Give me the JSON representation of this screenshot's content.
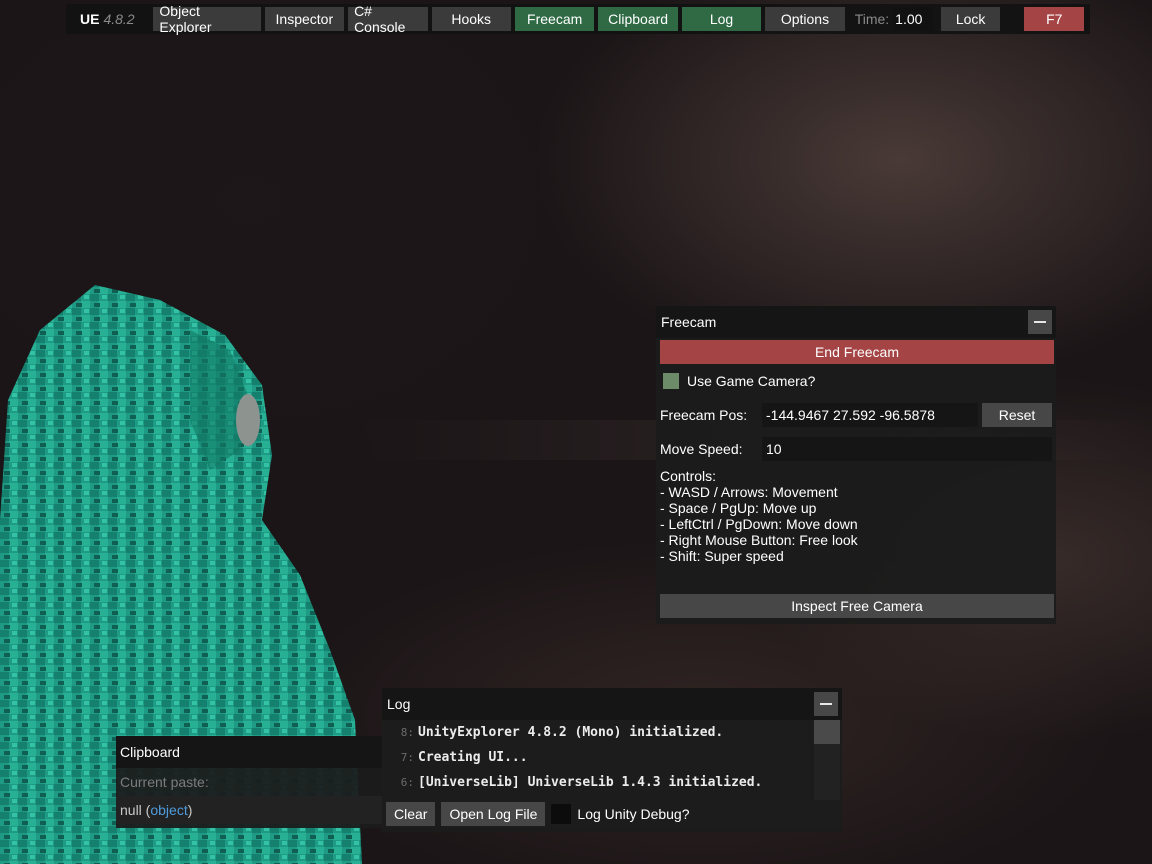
{
  "toolbar": {
    "brand": "UE",
    "version": "4.8.2",
    "buttons": [
      {
        "label": "Object Explorer",
        "active": false
      },
      {
        "label": "Inspector",
        "active": false
      },
      {
        "label": "C# Console",
        "active": false
      },
      {
        "label": "Hooks",
        "active": false
      },
      {
        "label": "Freecam",
        "active": true
      },
      {
        "label": "Clipboard",
        "active": true
      },
      {
        "label": "Log",
        "active": true
      },
      {
        "label": "Options",
        "active": false
      }
    ],
    "time_label": "Time:",
    "time_value": "1.00",
    "lock_label": "Lock",
    "f7_label": "F7"
  },
  "freecam": {
    "title": "Freecam",
    "end_button": "End Freecam",
    "use_game_camera_label": "Use Game Camera?",
    "use_game_camera_checked": true,
    "pos_label": "Freecam Pos:",
    "pos_value": "-144.9467 27.592 -96.5878",
    "reset_label": "Reset",
    "speed_label": "Move Speed:",
    "speed_value": "10",
    "controls": [
      "Controls:",
      "- WASD / Arrows: Movement",
      "- Space / PgUp: Move up",
      "- LeftCtrl / PgDown: Move down",
      "- Right Mouse Button: Free look",
      "- Shift: Super speed"
    ],
    "inspect_button": "Inspect Free Camera"
  },
  "log": {
    "title": "Log",
    "lines": [
      {
        "num": "8:",
        "text": "UnityExplorer 4.8.2 (Mono) initialized."
      },
      {
        "num": "7:",
        "text": "Creating UI..."
      },
      {
        "num": "6:",
        "text": "[UniverseLib] UniverseLib 1.4.3 initialized."
      }
    ],
    "clear_label": "Clear",
    "open_file_label": "Open Log File",
    "unity_debug_label": "Log Unity Debug?"
  },
  "clipboard": {
    "title": "Clipboard",
    "current_paste_label": "Current paste:",
    "value_prefix": "null (",
    "value_type": "object",
    "value_suffix": ")"
  },
  "colors": {
    "active_button": "#2f6a45",
    "danger_button": "#a54444",
    "checkbox_on": "#6c8b69",
    "type_keyword": "#4d9cdd",
    "cloak_teal": "#1f9a84"
  }
}
